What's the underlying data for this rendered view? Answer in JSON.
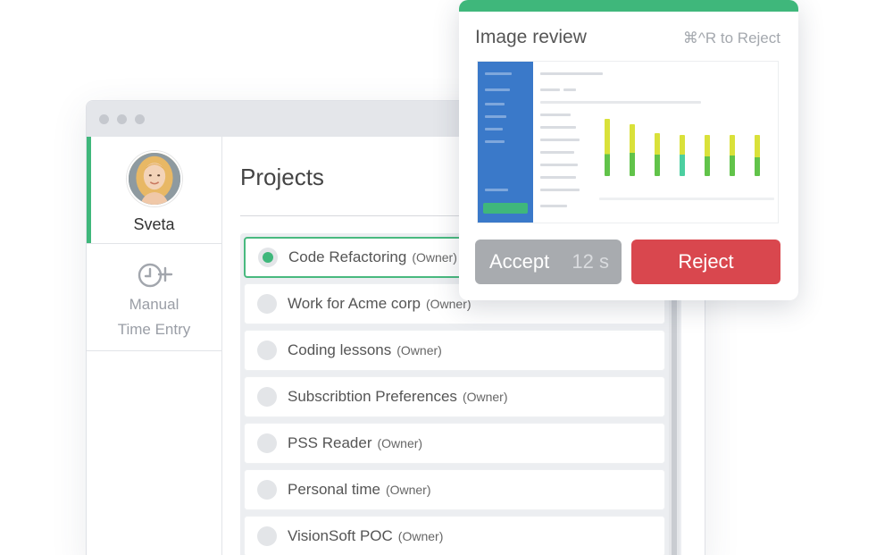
{
  "sidebar": {
    "user_name": "Sveta",
    "manual_entry_line1": "Manual",
    "manual_entry_line2": "Time Entry"
  },
  "main": {
    "title": "Projects",
    "projects": [
      {
        "name": "Code Refactoring",
        "role": "(Owner)",
        "selected": true
      },
      {
        "name": "Work for Acme corp",
        "role": "(Owner)",
        "selected": false
      },
      {
        "name": "Coding lessons",
        "role": "(Owner)",
        "selected": false
      },
      {
        "name": "Subscribtion Preferences",
        "role": "(Owner)",
        "selected": false
      },
      {
        "name": "PSS Reader",
        "role": "(Owner)",
        "selected": false
      },
      {
        "name": "Personal time",
        "role": "(Owner)",
        "selected": false
      },
      {
        "name": "VisionSoft POC",
        "role": "(Owner)",
        "selected": false
      }
    ]
  },
  "review": {
    "title": "Image review",
    "shortcut_hint": "⌘^R to Reject",
    "accept_label": "Accept",
    "accept_countdown": "12 s",
    "reject_label": "Reject"
  },
  "colors": {
    "accent_green": "#3fb77b",
    "reject_red": "#d9474e",
    "accept_gray": "#a8abaf",
    "thumb_sidebar_blue": "#3a79c9"
  },
  "icons": {
    "manual_entry": "clock-plus-icon",
    "radio": "radio-icon"
  }
}
